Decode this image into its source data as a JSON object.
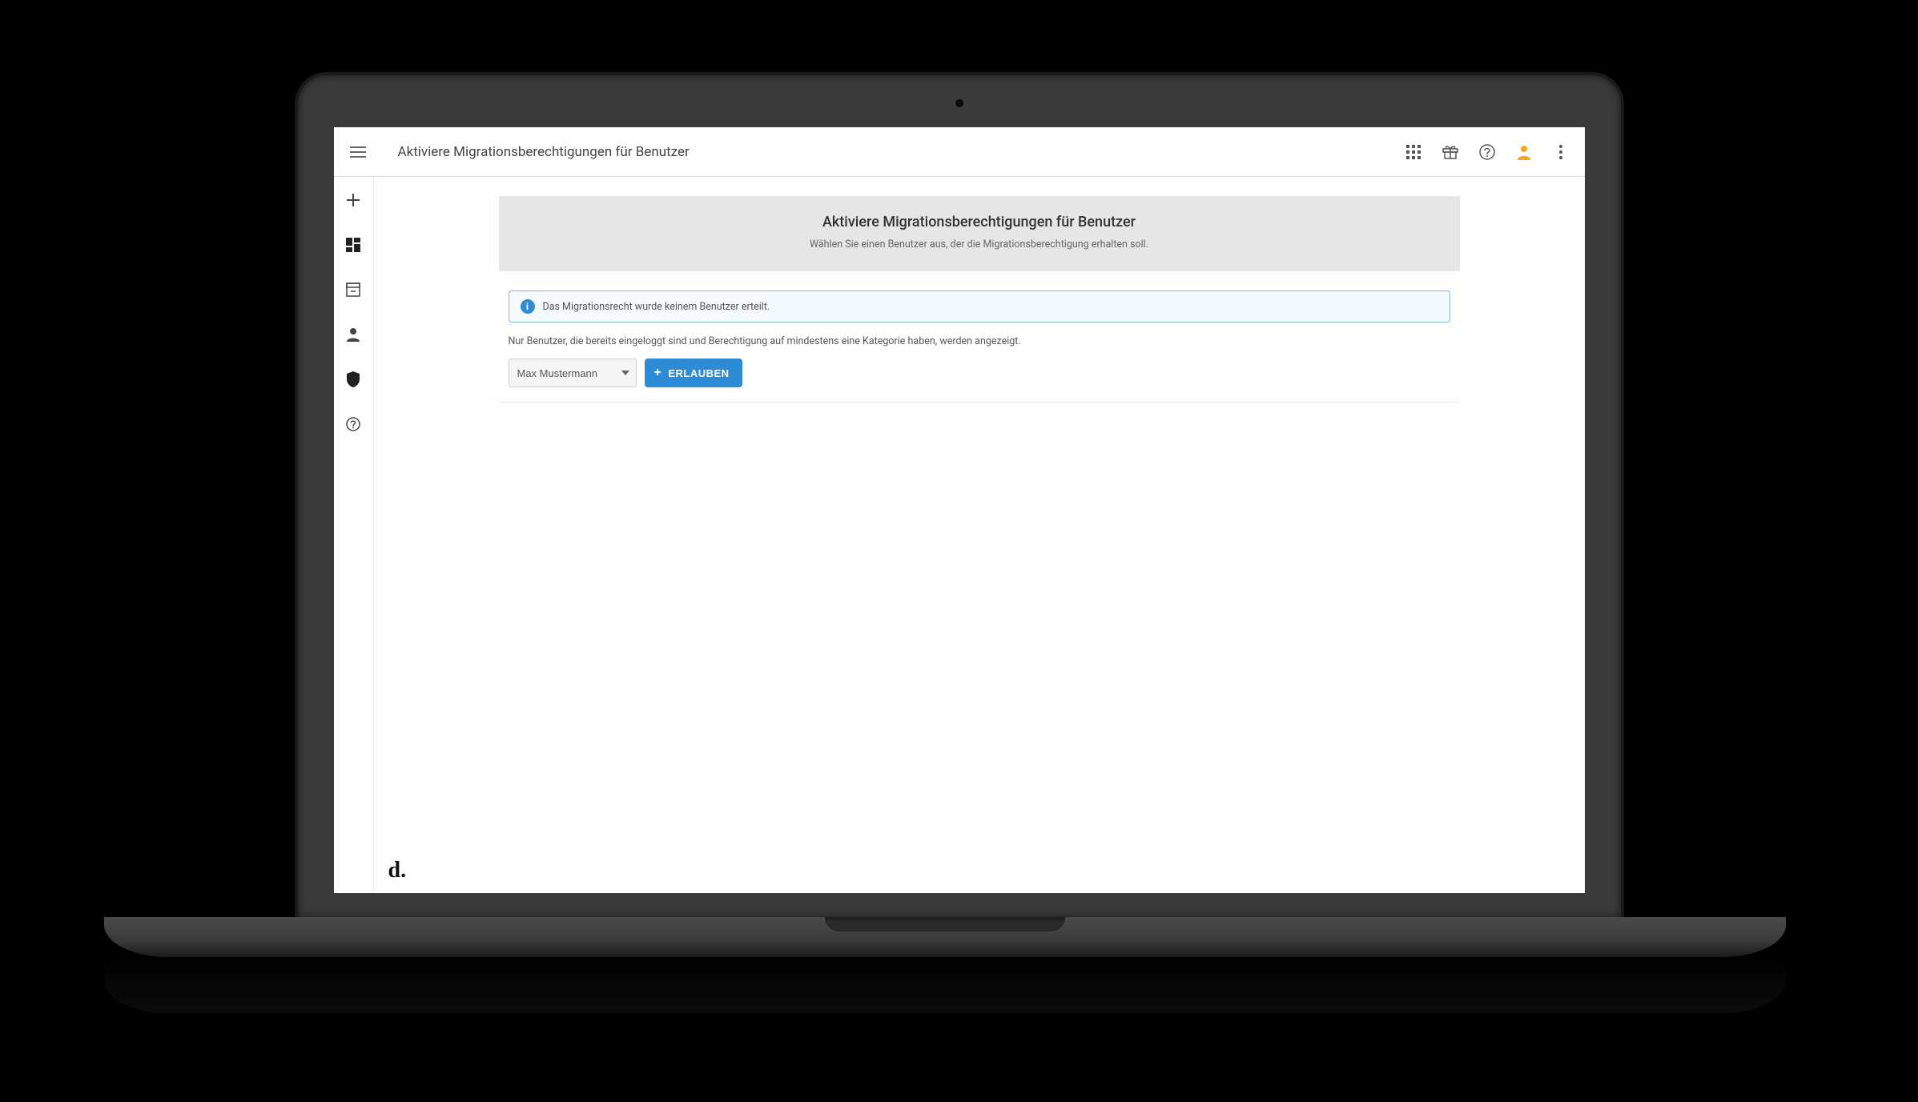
{
  "header": {
    "title": "Aktiviere Migrationsberechtigungen für Benutzer"
  },
  "card": {
    "title": "Aktiviere Migrationsberechtigungen für Benutzer",
    "subtitle": "Wählen Sie einen Benutzer aus, der die Migrationsberechtigung erhalten soll."
  },
  "info": {
    "message": "Das Migrationsrecht wurde keinem Benutzer erteilt."
  },
  "helper": "Nur Benutzer, die bereits eingeloggt sind und Berechtigung auf mindestens eine Kategorie haben, werden angezeigt.",
  "form": {
    "selected_user": "Max Mustermann",
    "allow_label": "ERLAUBEN"
  },
  "brand": "d."
}
